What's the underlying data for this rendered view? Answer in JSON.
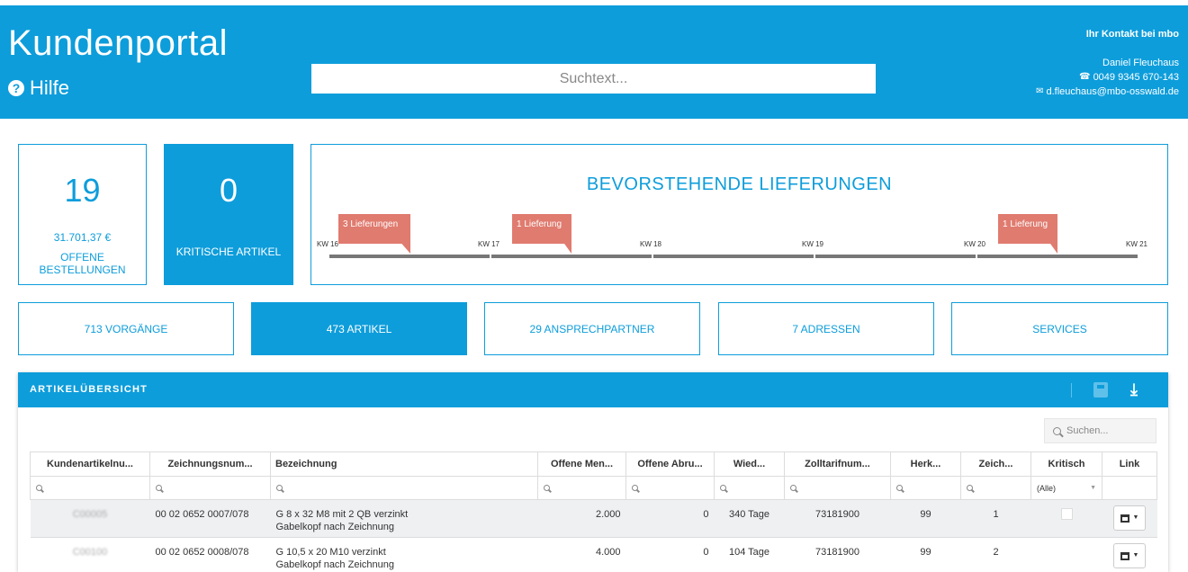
{
  "header": {
    "title": "Kundenportal",
    "help_label": "Hilfe",
    "search_placeholder": "Suchtext...",
    "contact_title": "Ihr Kontakt bei mbo",
    "contact_name": "Daniel Fleuchaus",
    "contact_phone": "0049 9345 670-143",
    "contact_email": "d.fleuchaus@mbo-osswald.de"
  },
  "kpis": {
    "open_orders_count": "19",
    "open_orders_amount": "31.701,37 €",
    "open_orders_label": "OFFENE BESTELLUNGEN",
    "critical_count": "0",
    "critical_label": "KRITISCHE ARTIKEL"
  },
  "deliveries": {
    "title": "BEVORSTEHENDE LIEFERUNGEN",
    "weeks": [
      "KW 16",
      "KW 17",
      "KW 18",
      "KW 19",
      "KW 20",
      "KW 21"
    ],
    "flags": [
      "3 Lieferungen",
      "1 Lieferung",
      "1 Lieferung"
    ]
  },
  "tiles": [
    "713 VORGÄNGE",
    "473 ARTIKEL",
    "29 ANSPRECHPARTNER",
    "7 ADRESSEN",
    "SERVICES"
  ],
  "panel": {
    "title": "ARTIKELÜBERSICHT",
    "search_placeholder": "Suchen...",
    "columns": [
      "Kundenartikelnu...",
      "Zeichnungsnum...",
      "Bezeichnung",
      "Offene Men...",
      "Offene Abru...",
      "Wied...",
      "Zolltarifnum...",
      "Herk...",
      "Zeich...",
      "Kritisch",
      "Link"
    ],
    "filter_all": "(Alle)",
    "rows": [
      {
        "customer_no": "C00005",
        "drawing_no": "00 02 0652 0007/078",
        "desc1": "G 8 x 32 M8 mit 2 QB verzinkt",
        "desc2": "Gabelkopf nach Zeichnung",
        "open_qty": "2.000",
        "open_calls": "0",
        "repl": "340 Tage",
        "tariff": "73181900",
        "origin": "99",
        "drawing_idx": "1"
      },
      {
        "customer_no": "C00100",
        "drawing_no": "00 02 0652 0008/078",
        "desc1": "G 10,5 x 20 M10 verzinkt",
        "desc2": "Gabelkopf nach Zeichnung",
        "open_qty": "4.000",
        "open_calls": "0",
        "repl": "104 Tage",
        "tariff": "73181900",
        "origin": "99",
        "drawing_idx": "2"
      }
    ]
  },
  "colors": {
    "primary": "#0d9ddb",
    "flag": "#e07b6f"
  }
}
